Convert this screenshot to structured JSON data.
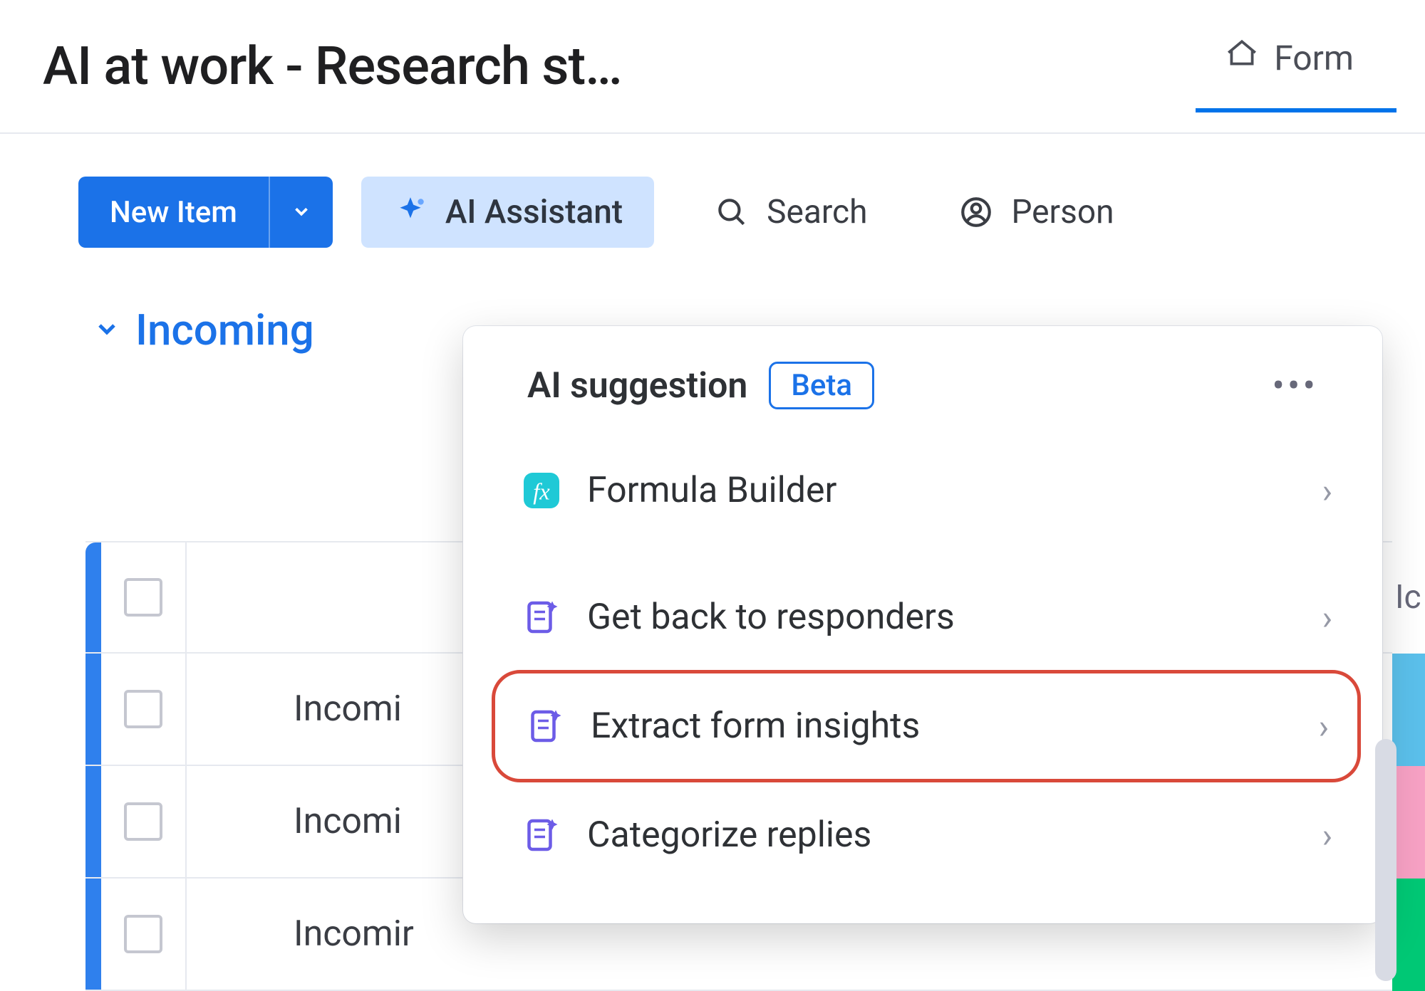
{
  "header": {
    "board_title": "AI at work - Research st…",
    "form_tab_label": "Form"
  },
  "toolbar": {
    "new_item_label": "New Item",
    "ai_assistant_label": "AI Assistant",
    "search_label": "Search",
    "person_label": "Person"
  },
  "group": {
    "name": "Incoming"
  },
  "table": {
    "status_header_fragment": "Ic",
    "rows": [
      {
        "name": "Incomi"
      },
      {
        "name": "Incomi"
      },
      {
        "name": "Incomir"
      }
    ]
  },
  "popover": {
    "title": "AI suggestion",
    "badge": "Beta",
    "items": [
      {
        "key": "formula-builder",
        "label": "Formula Builder",
        "icon": "formula-icon"
      },
      {
        "key": "get-back-to-responders",
        "label": "Get back to responders",
        "icon": "doc-sparkle-icon"
      },
      {
        "key": "extract-form-insights",
        "label": "Extract form insights",
        "icon": "doc-sparkle-icon",
        "highlight": true
      },
      {
        "key": "categorize-replies",
        "label": "Categorize replies",
        "icon": "doc-sparkle-icon"
      }
    ]
  },
  "colors": {
    "primary": "#1b72e8",
    "ai_pill_bg": "#cfe3ff",
    "highlight_border": "#d9493a",
    "status_blue": "#5bc0eb",
    "status_pink": "#f7a1c4",
    "status_green": "#00c875"
  }
}
